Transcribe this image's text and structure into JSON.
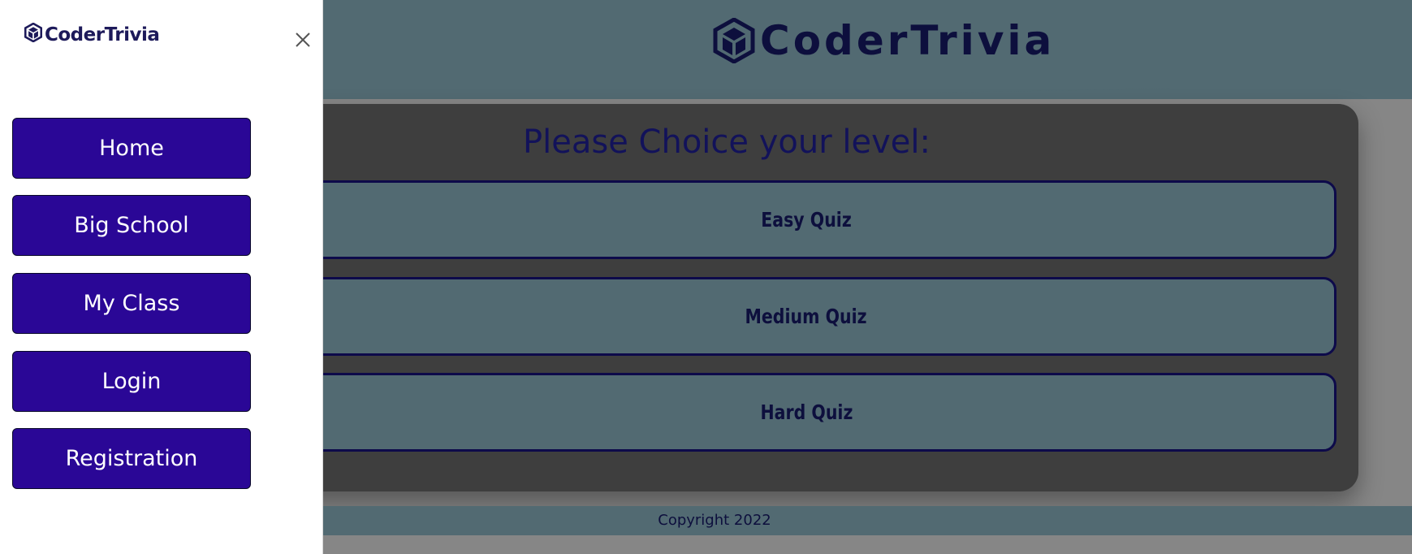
{
  "header": {
    "brand": "CoderTrivia"
  },
  "quiz": {
    "title": "Please Choice your level:",
    "levels": [
      "Easy Quiz",
      "Medium Quiz",
      "Hard Quiz"
    ]
  },
  "footer": {
    "copyright": "Copyright 2022"
  },
  "sidebar": {
    "brand": "CoderTrivia",
    "close_icon": "close-icon",
    "items": [
      "Home",
      "Big School",
      "My Class",
      "Login",
      "Registration"
    ]
  },
  "colors": {
    "header_bg": "#526a72",
    "panel_bg": "#3e3e3e",
    "nav_button": "#2a0796",
    "brand_text": "#0d0f3d"
  }
}
